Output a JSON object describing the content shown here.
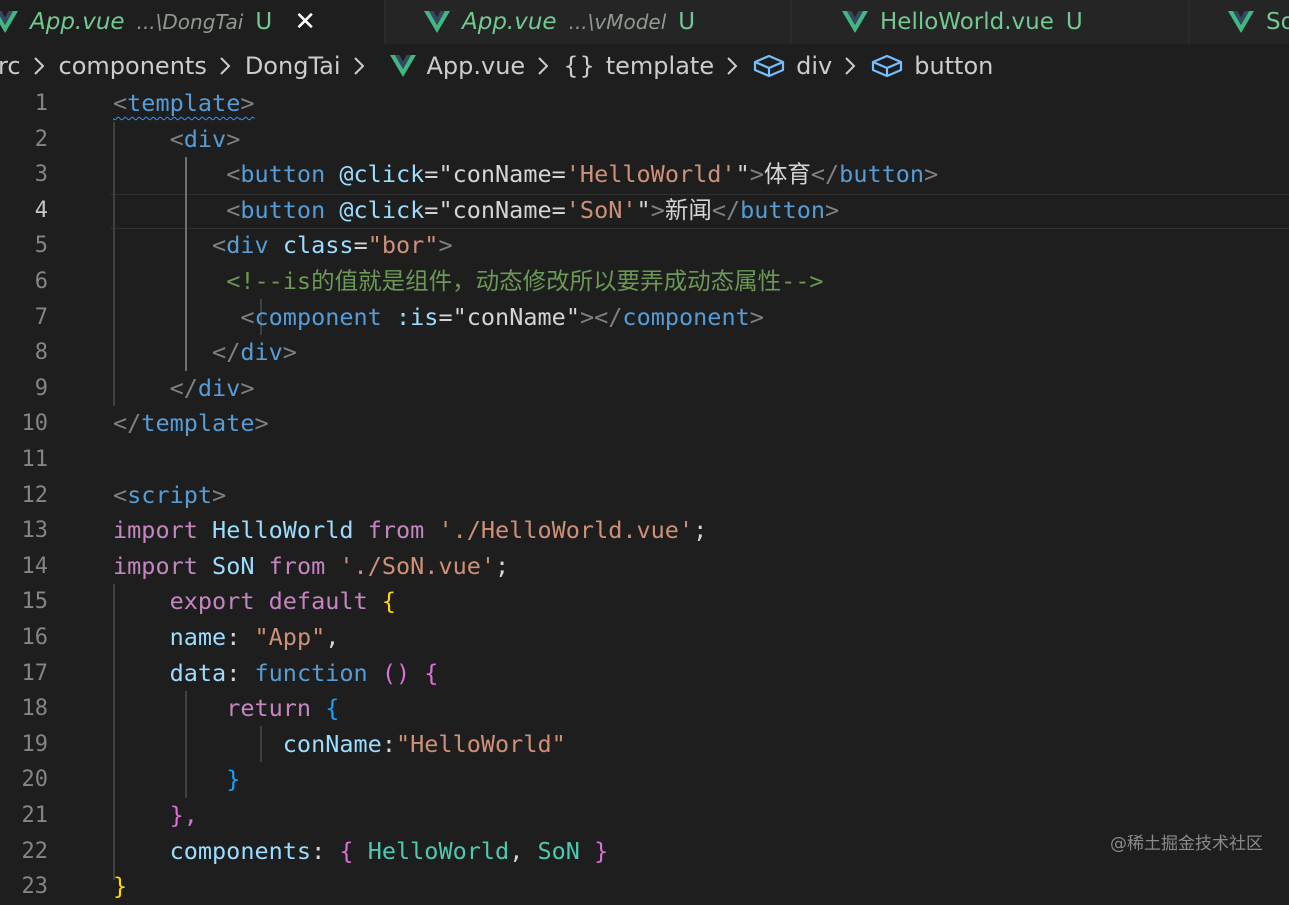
{
  "tabs": [
    {
      "name": "App.vue",
      "path": "...\\DongTai",
      "status": "U",
      "active": true,
      "close": "✕"
    },
    {
      "name": "App.vue",
      "path": "...\\vModel",
      "status": "U",
      "active": false
    },
    {
      "name": "HelloWorld.vue",
      "status": "U",
      "active": false
    },
    {
      "name": "So",
      "active": false
    }
  ],
  "breadcrumb": {
    "src": "rc",
    "components": "components",
    "dongtai": "DongTai",
    "file": "App.vue",
    "braces": "{}",
    "template": "template",
    "div": "div",
    "button": "button"
  },
  "editor": {
    "current_line": 4,
    "line_numbers": [
      "1",
      "2",
      "3",
      "4",
      "5",
      "6",
      "7",
      "8",
      "9",
      "10",
      "11",
      "12",
      "13",
      "14",
      "15",
      "16",
      "17",
      "18",
      "19",
      "20",
      "21",
      "22",
      "23"
    ],
    "tokens": {
      "lt": "<",
      "gt": ">",
      "lt_slash": "</",
      "template": "template",
      "div": "div",
      "button": "button",
      "component": "component",
      "script": "script",
      "click_attr": "@click",
      "eq": "=",
      "q": "\"",
      "conname_eq": "conName=",
      "hello_single": "'HelloWorld'",
      "son_single": "'SoN'",
      "btn1_text": "体育",
      "btn2_text": "新闻",
      "class_attr": "class",
      "bor": "\"bor\"",
      "comment": "<!--is的值就是组件，动态修改所以要弄成动态属性-->",
      "is_attr": ":is",
      "conname": "conName",
      "import": "import",
      "hello": "HelloWorld",
      "from": "from",
      "hello_path": "'./HelloWorld.vue'",
      "semi": ";",
      "son": "SoN",
      "son_path": "'./SoN.vue'",
      "export": "export",
      "default": "default",
      "lbrace": "{",
      "rbrace": "}",
      "name_key": "name",
      "colon": ":",
      "app_str": "\"App\"",
      "comma": ",",
      "data_key": "data",
      "function": "function",
      "parens": "()",
      "return": "return",
      "conname_key": "conName",
      "hello_str": "\"HelloWorld\"",
      "brace_comma": "},",
      "components_key": "components"
    }
  },
  "watermark": "@稀土掘金技术社区",
  "colors": {
    "background": "#1e1e1e",
    "tab_bar": "#252526",
    "untracked_green": "#73c991",
    "vue_green": "#41b883",
    "tag_blue": "#569cd6",
    "attribute_blue": "#9cdcfe",
    "string_orange": "#ce9178",
    "keyword_purple": "#c586c0",
    "comment_green": "#6a9955"
  },
  "icons": {
    "tab_file": "vue-logo-icon",
    "breadcrumb_separator": "chevron-right-icon",
    "breadcrumb_element": "cube-element-icon"
  }
}
